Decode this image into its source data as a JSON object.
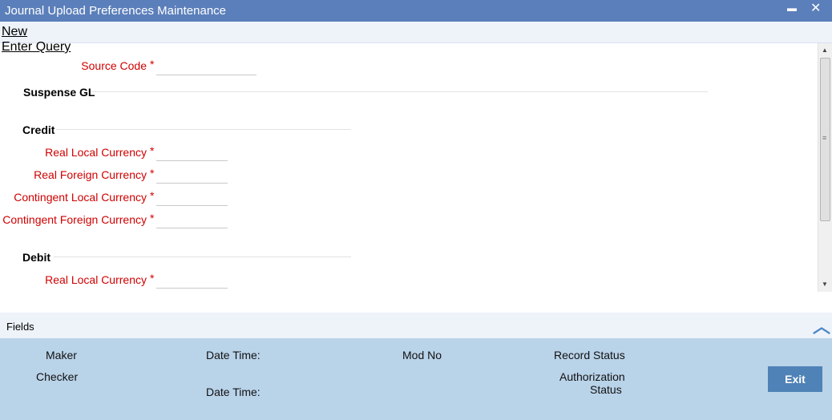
{
  "window": {
    "title": "Journal Upload Preferences Maintenance",
    "minimize": "▬",
    "close": "✕"
  },
  "menu": {
    "new": "New",
    "enter_query": "Enter Query"
  },
  "form": {
    "source_code": {
      "label": "Source Code",
      "value": ""
    },
    "suspense_gl": "Suspense GL",
    "credit": {
      "title": "Credit",
      "real_local": {
        "label": "Real Local Currency",
        "value": ""
      },
      "real_foreign": {
        "label": "Real Foreign Currency",
        "value": ""
      },
      "contingent_local": {
        "label": "Contingent Local Currency",
        "value": ""
      },
      "contingent_foreign": {
        "label": "Contingent Foreign Currency",
        "value": ""
      }
    },
    "debit": {
      "title": "Debit",
      "real_local": {
        "label": "Real Local Currency",
        "value": ""
      }
    },
    "required_mark": "*"
  },
  "fields_bar": {
    "label": "Fields"
  },
  "audit": {
    "maker": "Maker",
    "date_time_1": "Date Time:",
    "mod_no": "Mod No",
    "record_status": "Record Status",
    "checker": "Checker",
    "date_time_2": "Date Time:",
    "authorization": "Authorization",
    "status": "Status",
    "exit": "Exit"
  },
  "colors": {
    "titlebar": "#5b7fba",
    "required": "#d00000",
    "audit_bg": "#b9d3e9",
    "exit_btn": "#4f82b6"
  }
}
